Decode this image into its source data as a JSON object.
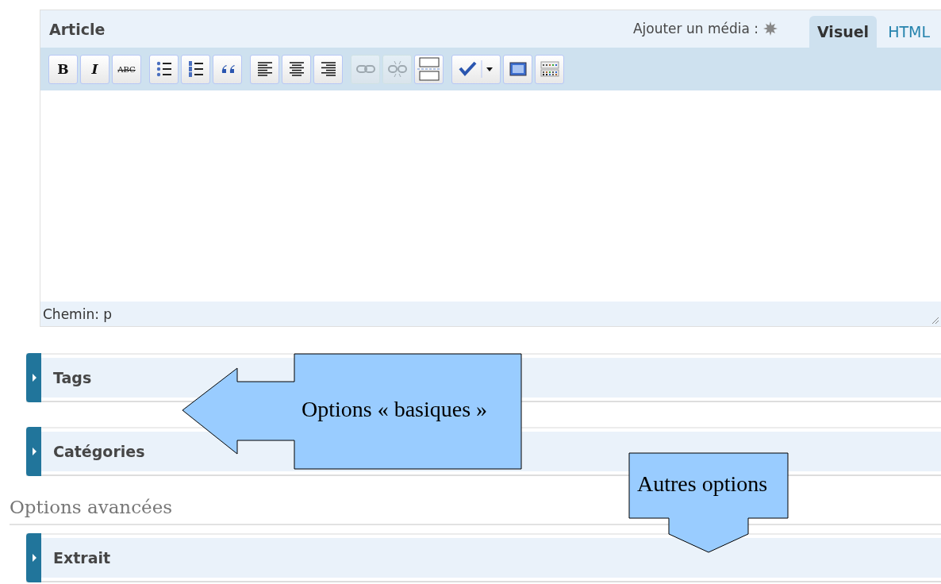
{
  "editor": {
    "title": "Article",
    "media_label": "Ajouter un média :",
    "tabs": [
      {
        "label": "Visuel",
        "selected": true
      },
      {
        "label": "HTML",
        "selected": false
      }
    ],
    "toolbar": [
      {
        "kind": "bold",
        "label": "B",
        "disabled": false
      },
      {
        "kind": "italic",
        "label": "I",
        "disabled": false
      },
      {
        "kind": "strike",
        "label": "ABC",
        "disabled": false
      },
      {
        "kind": "bullets",
        "disabled": false
      },
      {
        "kind": "numbers",
        "disabled": false
      },
      {
        "kind": "quote",
        "disabled": false
      },
      {
        "kind": "align-left",
        "disabled": false
      },
      {
        "kind": "align-center",
        "disabled": false
      },
      {
        "kind": "align-right",
        "disabled": false
      },
      {
        "kind": "link",
        "disabled": true
      },
      {
        "kind": "unlink",
        "disabled": true
      },
      {
        "kind": "more",
        "disabled": false
      },
      {
        "kind": "spellcheck",
        "disabled": false
      },
      {
        "kind": "fullscreen",
        "disabled": false
      },
      {
        "kind": "kitchen-sink",
        "disabled": false
      }
    ],
    "path": "Chemin: p"
  },
  "panels": [
    {
      "title": "Tags",
      "expanded": false
    },
    {
      "title": "Catégories",
      "expanded": false
    }
  ],
  "advanced": {
    "heading": "Options avancées",
    "panels": [
      {
        "title": "Extrait",
        "expanded": false
      }
    ]
  },
  "callouts": [
    {
      "text": "Options « basiques »",
      "kind": "left"
    },
    {
      "text": "Autres options",
      "kind": "down"
    }
  ]
}
